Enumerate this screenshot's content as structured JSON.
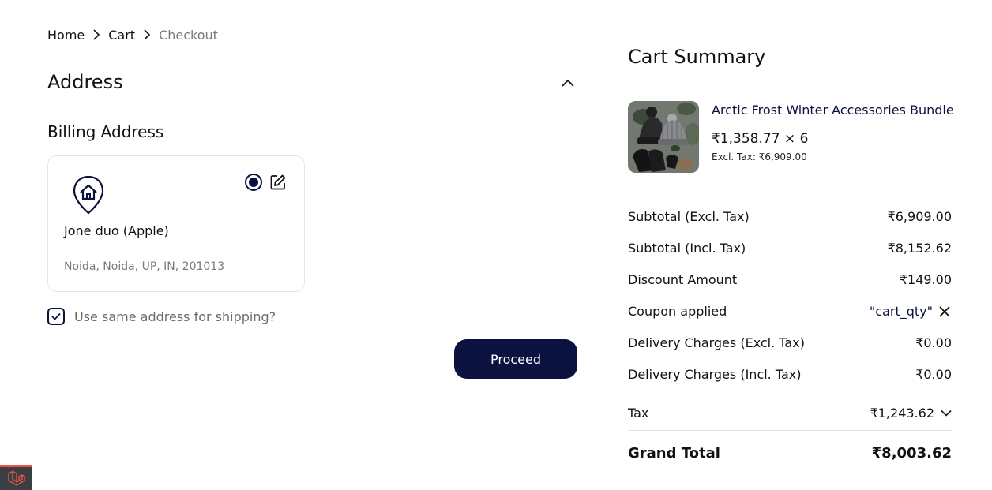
{
  "breadcrumb": {
    "items": [
      {
        "label": "Home"
      },
      {
        "label": "Cart"
      },
      {
        "label": "Checkout"
      }
    ]
  },
  "address": {
    "section_title": "Address",
    "billing_title": "Billing Address",
    "card": {
      "name": "Jone duo (Apple)",
      "line": "Noida, Noida, UP, IN, 201013",
      "selected": true
    },
    "same_address_label": "Use same address for shipping?",
    "same_address_checked": true,
    "proceed_label": "Proceed"
  },
  "summary": {
    "title": "Cart Summary",
    "product": {
      "name": "Arctic Frost Winter Accessories Bundle",
      "price_line": "₹1,358.77 × 6",
      "excl_tax_line": "Excl. Tax: ₹6,909.00"
    },
    "rows": [
      {
        "label": "Subtotal (Excl. Tax)",
        "value": "₹6,909.00"
      },
      {
        "label": "Subtotal (Incl. Tax)",
        "value": "₹8,152.62"
      },
      {
        "label": "Discount Amount",
        "value": "₹149.00"
      },
      {
        "label": "Coupon applied",
        "value": "\"cart_qty\""
      },
      {
        "label": "Delivery Charges (Excl. Tax)",
        "value": "₹0.00"
      },
      {
        "label": "Delivery Charges (Incl. Tax)",
        "value": "₹0.00"
      }
    ],
    "tax": {
      "label": "Tax",
      "value": "₹1,243.62"
    },
    "grand_total": {
      "label": "Grand Total",
      "value": "₹8,003.62"
    }
  },
  "colors": {
    "accent": "#0b1240",
    "muted_text": "#7a7a7a",
    "border": "#e5e5e5"
  },
  "icons": [
    "chevron-right-icon",
    "chevron-up-icon",
    "home-pin-icon",
    "edit-icon",
    "check-icon",
    "close-icon",
    "chevron-down-icon",
    "laravel-icon"
  ]
}
